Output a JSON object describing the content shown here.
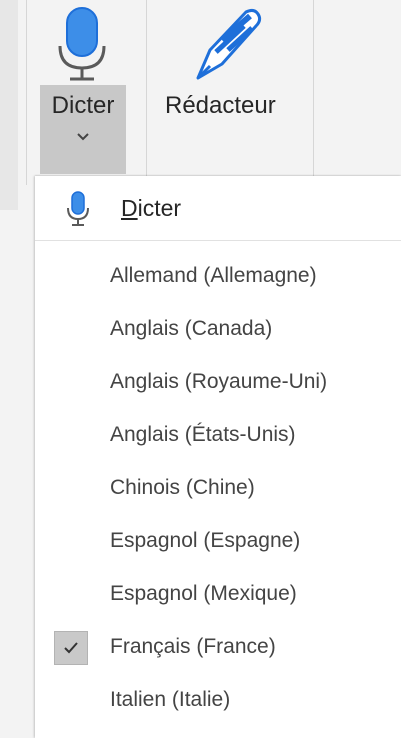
{
  "ribbon": {
    "dicter_label": "Dicter",
    "redacteur_label": "Rédacteur"
  },
  "menu": {
    "header_label_first": "D",
    "header_label_rest": "icter",
    "languages": [
      {
        "label": "Allemand (Allemagne)",
        "checked": false
      },
      {
        "label": "Anglais (Canada)",
        "checked": false
      },
      {
        "label": "Anglais (Royaume-Uni)",
        "checked": false
      },
      {
        "label": "Anglais (États-Unis)",
        "checked": false
      },
      {
        "label": "Chinois (Chine)",
        "checked": false
      },
      {
        "label": "Espagnol (Espagne)",
        "checked": false
      },
      {
        "label": "Espagnol (Mexique)",
        "checked": false
      },
      {
        "label": "Français (France)",
        "checked": true
      },
      {
        "label": "Italien (Italie)",
        "checked": false
      }
    ]
  },
  "colors": {
    "accent_blue": "#1e6fd9",
    "selected_bg": "#c8c8c8"
  },
  "icons": {
    "mic": "microphone-icon",
    "pen": "pen-icon",
    "chevron": "chevron-down-icon",
    "check": "checkmark-icon"
  }
}
